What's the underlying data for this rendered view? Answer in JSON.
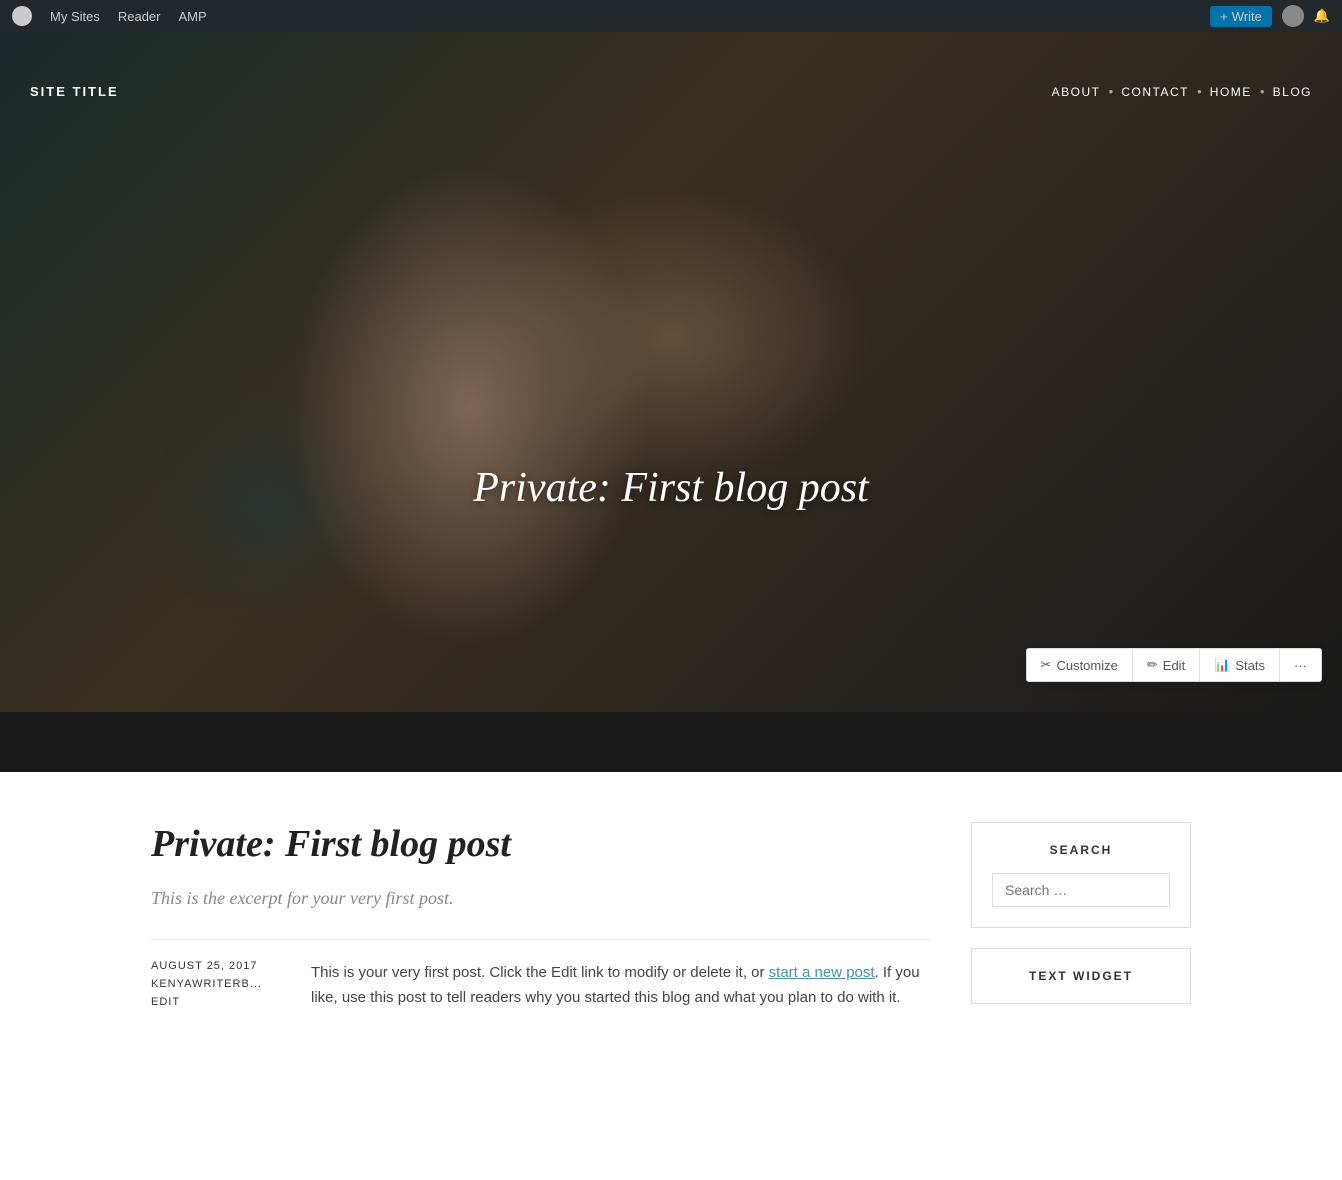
{
  "admin_bar": {
    "my_sites": "My Sites",
    "reader": "Reader",
    "amp": "AMP",
    "write": "Write",
    "wp_icon": "W"
  },
  "site_header": {
    "site_title": "SITE TITLE",
    "nav_items": [
      {
        "label": "ABOUT"
      },
      {
        "label": "CONTACT"
      },
      {
        "label": "HOME"
      },
      {
        "label": "BLOG"
      }
    ]
  },
  "hero": {
    "post_title": "Private: First blog post"
  },
  "admin_toolbar": {
    "customize_label": "Customize",
    "edit_label": "Edit",
    "stats_label": "Stats",
    "more_label": "···"
  },
  "article": {
    "title": "Private: First blog post",
    "excerpt": "This is the excerpt for your very first post.",
    "date": "AUGUST 25, 2017",
    "author": "KENYAWRITERB...",
    "edit": "EDIT",
    "content_start": "This is your very first post. Click the Edit link to modify or delete it, or ",
    "content_link": "start a new post",
    "content_end": ". If you like, use this post to tell readers why you started this blog and what you plan to do with it."
  },
  "sidebar": {
    "search_widget": {
      "title": "SEARCH",
      "placeholder": "Search …"
    },
    "text_widget": {
      "title": "TEXT WIDGET"
    }
  }
}
